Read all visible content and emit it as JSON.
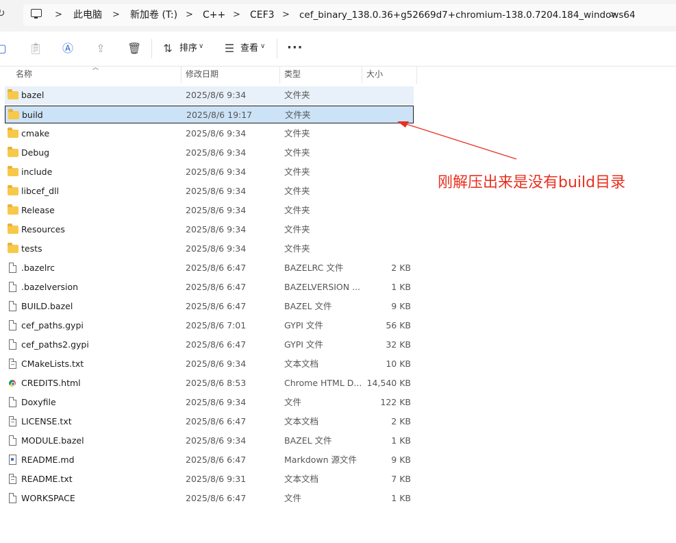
{
  "breadcrumbs": [
    "此电脑",
    "新加卷 (T:)",
    "C++",
    "CEF3",
    "cef_binary_138.0.36+g52669d7+chromium-138.0.7204.184_windows64"
  ],
  "toolbar": {
    "sort_label": "排序",
    "view_label": "查看",
    "more_label": "···",
    "icons": [
      "new-icon",
      "paste-icon",
      "rename-icon",
      "share-icon",
      "delete-icon"
    ]
  },
  "columns": {
    "name": "名称",
    "date": "修改日期",
    "type": "类型",
    "size": "大小"
  },
  "files": [
    {
      "name": "bazel",
      "date": "2025/8/6 9:34",
      "type": "文件夹",
      "size": "",
      "icon": "folder",
      "state": "hover"
    },
    {
      "name": "build",
      "date": "2025/8/6 19:17",
      "type": "文件夹",
      "size": "",
      "icon": "folder",
      "state": "selected"
    },
    {
      "name": "cmake",
      "date": "2025/8/6 9:34",
      "type": "文件夹",
      "size": "",
      "icon": "folder"
    },
    {
      "name": "Debug",
      "date": "2025/8/6 9:34",
      "type": "文件夹",
      "size": "",
      "icon": "folder"
    },
    {
      "name": "include",
      "date": "2025/8/6 9:34",
      "type": "文件夹",
      "size": "",
      "icon": "folder"
    },
    {
      "name": "libcef_dll",
      "date": "2025/8/6 9:34",
      "type": "文件夹",
      "size": "",
      "icon": "folder"
    },
    {
      "name": "Release",
      "date": "2025/8/6 9:34",
      "type": "文件夹",
      "size": "",
      "icon": "folder"
    },
    {
      "name": "Resources",
      "date": "2025/8/6 9:34",
      "type": "文件夹",
      "size": "",
      "icon": "folder"
    },
    {
      "name": "tests",
      "date": "2025/8/6 9:34",
      "type": "文件夹",
      "size": "",
      "icon": "folder"
    },
    {
      "name": ".bazelrc",
      "date": "2025/8/6 6:47",
      "type": "BAZELRC 文件",
      "size": "2 KB",
      "icon": "file"
    },
    {
      "name": ".bazelversion",
      "date": "2025/8/6 6:47",
      "type": "BAZELVERSION ...",
      "size": "1 KB",
      "icon": "file"
    },
    {
      "name": "BUILD.bazel",
      "date": "2025/8/6 6:47",
      "type": "BAZEL 文件",
      "size": "9 KB",
      "icon": "file"
    },
    {
      "name": "cef_paths.gypi",
      "date": "2025/8/6 7:01",
      "type": "GYPI 文件",
      "size": "56 KB",
      "icon": "file"
    },
    {
      "name": "cef_paths2.gypi",
      "date": "2025/8/6 6:47",
      "type": "GYPI 文件",
      "size": "32 KB",
      "icon": "file"
    },
    {
      "name": "CMakeLists.txt",
      "date": "2025/8/6 9:34",
      "type": "文本文档",
      "size": "10 KB",
      "icon": "text"
    },
    {
      "name": "CREDITS.html",
      "date": "2025/8/6 8:53",
      "type": "Chrome HTML D...",
      "size": "14,540 KB",
      "icon": "chrome"
    },
    {
      "name": "Doxyfile",
      "date": "2025/8/6 9:34",
      "type": "文件",
      "size": "122 KB",
      "icon": "file"
    },
    {
      "name": "LICENSE.txt",
      "date": "2025/8/6 6:47",
      "type": "文本文档",
      "size": "2 KB",
      "icon": "text"
    },
    {
      "name": "MODULE.bazel",
      "date": "2025/8/6 9:34",
      "type": "BAZEL 文件",
      "size": "1 KB",
      "icon": "file"
    },
    {
      "name": "README.md",
      "date": "2025/8/6 6:47",
      "type": "Markdown 源文件",
      "size": "9 KB",
      "icon": "markdown"
    },
    {
      "name": "README.txt",
      "date": "2025/8/6 9:31",
      "type": "文本文档",
      "size": "7 KB",
      "icon": "text"
    },
    {
      "name": "WORKSPACE",
      "date": "2025/8/6 6:47",
      "type": "文件",
      "size": "1 KB",
      "icon": "file"
    }
  ],
  "annotation": {
    "text": "刚解压出来是没有build目录",
    "color": "#e8301f"
  },
  "colors": {
    "selected_bg": "#cce3f7",
    "hover_bg": "#e8f0f9",
    "folder": "#f8c84a"
  }
}
